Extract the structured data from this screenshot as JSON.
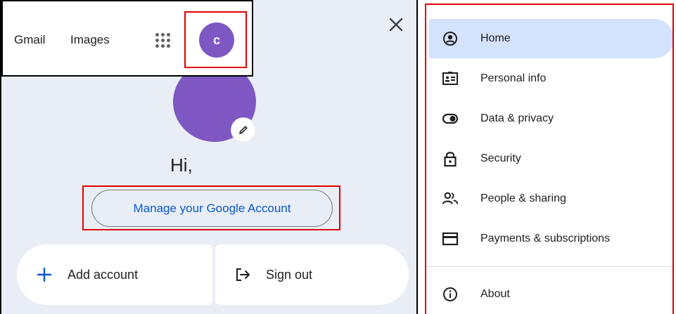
{
  "account_menu": {
    "links": {
      "gmail": "Gmail",
      "images": "Images"
    },
    "apps_icon": "google-apps-grid-icon",
    "avatar_initial": "c",
    "greeting": "Hi,",
    "manage_account_label": "Manage your Google Account",
    "add_account_label": "Add account",
    "sign_out_label": "Sign out",
    "colors": {
      "panel_bg": "#e9eef6",
      "avatar": "#7e57c2",
      "link_blue": "#0b57d0",
      "highlight_red": "#e00000"
    }
  },
  "account_nav": {
    "items": [
      {
        "label": "Home",
        "icon": "account-circle-icon",
        "active": true
      },
      {
        "label": "Personal info",
        "icon": "id-card-icon",
        "active": false
      },
      {
        "label": "Data & privacy",
        "icon": "toggle-icon",
        "active": false
      },
      {
        "label": "Security",
        "icon": "lock-icon",
        "active": false
      },
      {
        "label": "People & sharing",
        "icon": "people-icon",
        "active": false
      },
      {
        "label": "Payments & subscriptions",
        "icon": "credit-card-icon",
        "active": false
      },
      {
        "label": "About",
        "icon": "info-icon",
        "active": false
      }
    ],
    "colors": {
      "active_bg": "#d3e3fd"
    }
  }
}
